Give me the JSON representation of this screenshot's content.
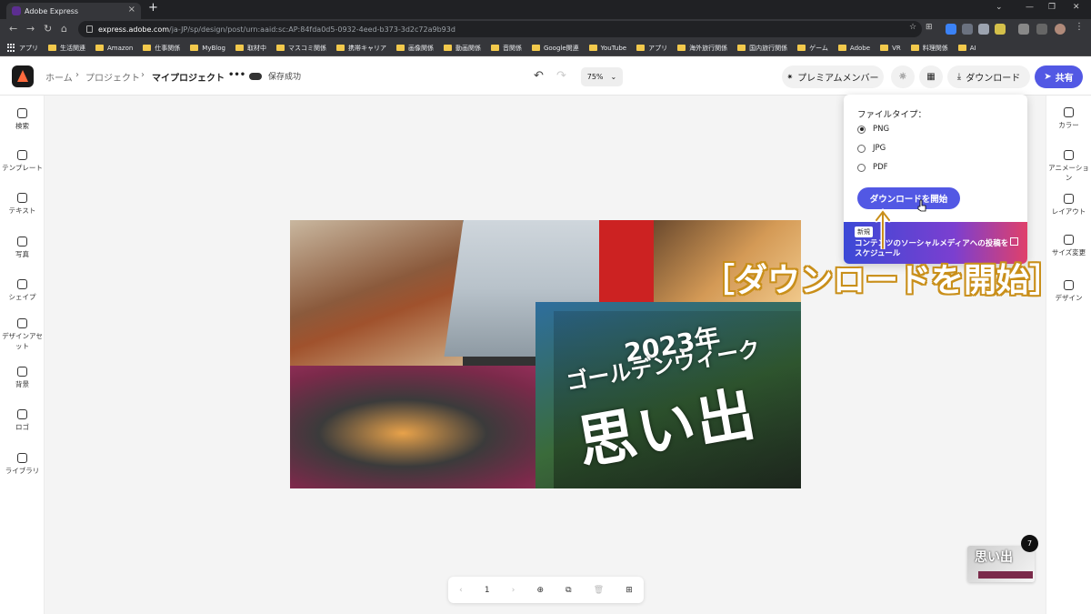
{
  "browser": {
    "tab_title": "Adobe Express",
    "url_host": "express.adobe.com",
    "url_path": "/ja-JP/sp/design/post/urn:aaid:sc:AP:84fda0d5-0932-4eed-b373-3d2c72a9b93d",
    "bookmarks": [
      "アプリ",
      "生活関連",
      "Amazon",
      "仕事関係",
      "MyBlog",
      "取材中",
      "マスコミ関係",
      "携帯キャリア",
      "画像関係",
      "動画関係",
      "音関係",
      "Google関連",
      "YouTube",
      "アプリ",
      "海外旅行関係",
      "国内旅行関係",
      "ゲーム",
      "Adobe",
      "VR",
      "料理関係",
      "AI"
    ]
  },
  "header": {
    "crumb_home": "ホーム",
    "crumb_project": "プロジェクト",
    "crumb_current": "マイプロジェクト",
    "more": "•••",
    "save_status": "保存成功",
    "zoom": "75%",
    "premium_label": "プレミアムメンバー",
    "download_label": "ダウンロード",
    "share_label": "共有"
  },
  "left_rail": [
    {
      "label": "検索",
      "icon": "search-icon"
    },
    {
      "label": "テンプレート",
      "icon": "template-icon"
    },
    {
      "label": "テキスト",
      "icon": "text-icon"
    },
    {
      "label": "写真",
      "icon": "photo-icon"
    },
    {
      "label": "シェイプ",
      "icon": "shape-icon"
    },
    {
      "label": "デザインアセット",
      "icon": "design-asset-icon"
    },
    {
      "label": "背景",
      "icon": "background-icon"
    },
    {
      "label": "ロゴ",
      "icon": "logo-icon"
    },
    {
      "label": "ライブラリ",
      "icon": "library-icon"
    }
  ],
  "right_rail": [
    {
      "label": "カラー",
      "icon": "palette-icon"
    },
    {
      "label": "アニメーション",
      "icon": "animation-icon"
    },
    {
      "label": "レイアウト",
      "icon": "layout-icon"
    },
    {
      "label": "サイズ変更",
      "icon": "resize-icon"
    },
    {
      "label": "デザイン",
      "icon": "magic-wand-icon"
    }
  ],
  "canvas": {
    "year_text": "2023年",
    "subtitle_text": "ゴールデンウィーク",
    "main_text": "思い出"
  },
  "download_popup": {
    "title": "ファイルタイプ：",
    "options": [
      "PNG",
      "JPG",
      "PDF"
    ],
    "selected": "PNG",
    "start_button": "ダウンロードを開始",
    "promo_badge": "新規",
    "promo_text": "コンテンツのソーシャルメディアへの投稿をスケジュール"
  },
  "annotation": "［ダウンロードを開始］",
  "pager": {
    "page_number": "1"
  },
  "thumbnail": {
    "text": "思い出",
    "count": "7"
  },
  "colors": {
    "accent": "#5258e4",
    "annotation_outline": "#c98f1a"
  }
}
